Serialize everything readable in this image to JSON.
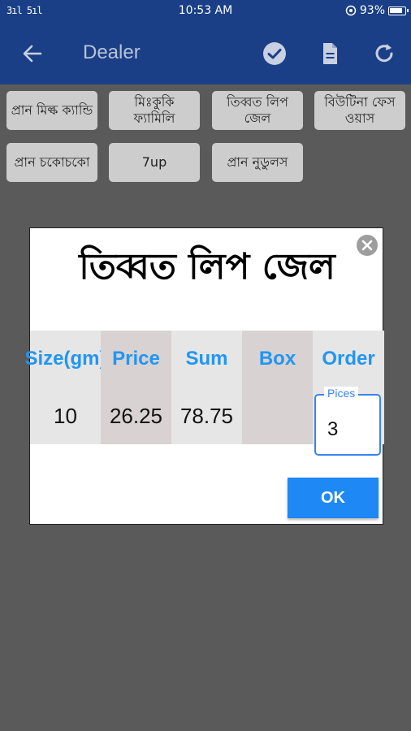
{
  "status_bar": {
    "signal": "3ıl 5ıl",
    "time": "10:53 AM",
    "battery": "93%"
  },
  "app_bar": {
    "title": "Dealer"
  },
  "chips": [
    {
      "label": "প্রান মিল্ক ক্যান্ডি"
    },
    {
      "label": "মিঃকুকি ফ্যামিলি"
    },
    {
      "label": "তিব্বত লিপ জেল"
    },
    {
      "label": "বিউটিনা ফেস ওয়াস"
    },
    {
      "label": "প্রান চকোচকো"
    },
    {
      "label": "7up"
    },
    {
      "label": "প্রান নুডুলস"
    }
  ],
  "dialog": {
    "title": "তিব্বত লিপ জেল",
    "columns": {
      "size": {
        "header": "Size(gm)",
        "value": "10"
      },
      "price": {
        "header": "Price",
        "value": "26.25"
      },
      "sum": {
        "header": "Sum",
        "value": "78.75"
      },
      "box": {
        "header": "Box",
        "value": ""
      },
      "order": {
        "header": "Order"
      }
    },
    "order_input": {
      "label": "Pices",
      "value": "3"
    },
    "ok_label": "OK"
  },
  "colors": {
    "primary": "#1a3f86",
    "accent": "#2196f3",
    "ok_button": "#1e88f5"
  }
}
